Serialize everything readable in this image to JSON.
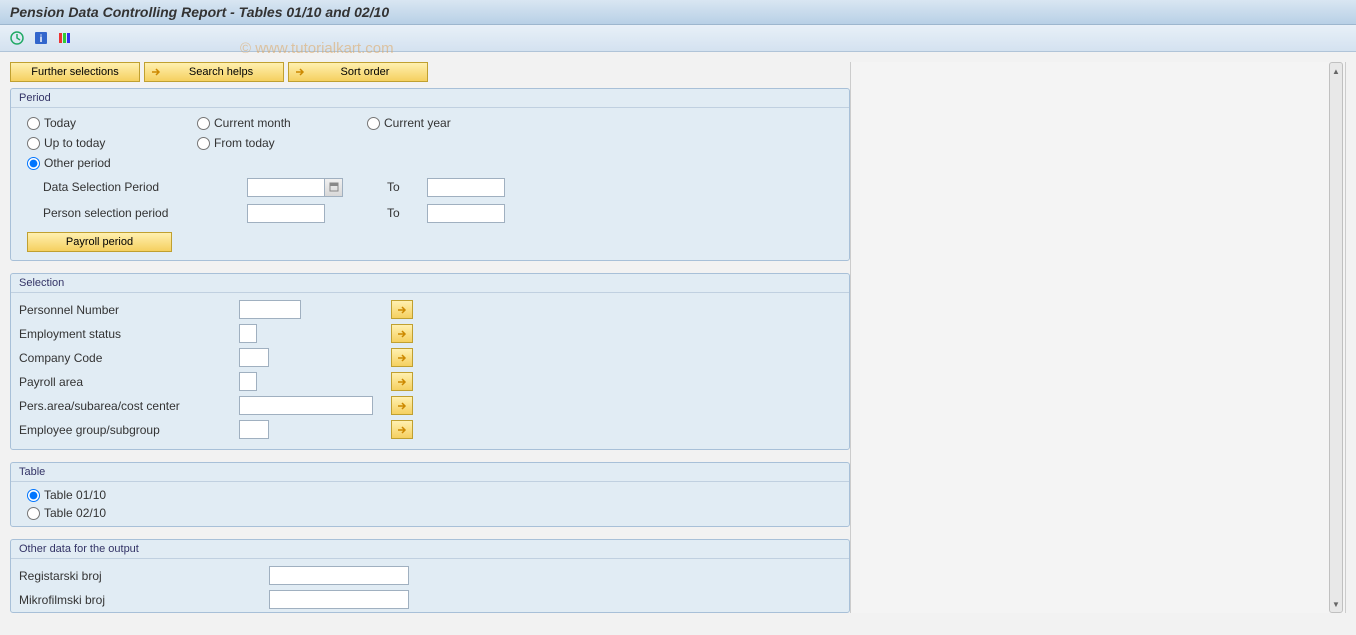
{
  "title": "Pension Data Controlling Report  - Tables 01/10 and 02/10",
  "watermark": "© www.tutorialkart.com",
  "toolbar_buttons": {
    "further": "Further selections",
    "search": "Search helps",
    "sort": "Sort order"
  },
  "period": {
    "title": "Period",
    "today": "Today",
    "current_month": "Current month",
    "current_year": "Current year",
    "up_to_today": "Up to today",
    "from_today": "From today",
    "other_period": "Other period",
    "data_sel": "Data Selection Period",
    "person_sel": "Person selection period",
    "to": "To",
    "payroll_btn": "Payroll period"
  },
  "selection": {
    "title": "Selection",
    "personnel": "Personnel Number",
    "emp_status": "Employment status",
    "company_code": "Company Code",
    "payroll_area": "Payroll area",
    "pers_area": "Pers.area/subarea/cost center",
    "emp_group": "Employee group/subgroup"
  },
  "table": {
    "title": "Table",
    "t01": "Table 01/10",
    "t02": "Table 02/10"
  },
  "other": {
    "title": "Other data for the output",
    "reg": "Registarski broj",
    "mikro": "Mikrofilmski broj"
  }
}
